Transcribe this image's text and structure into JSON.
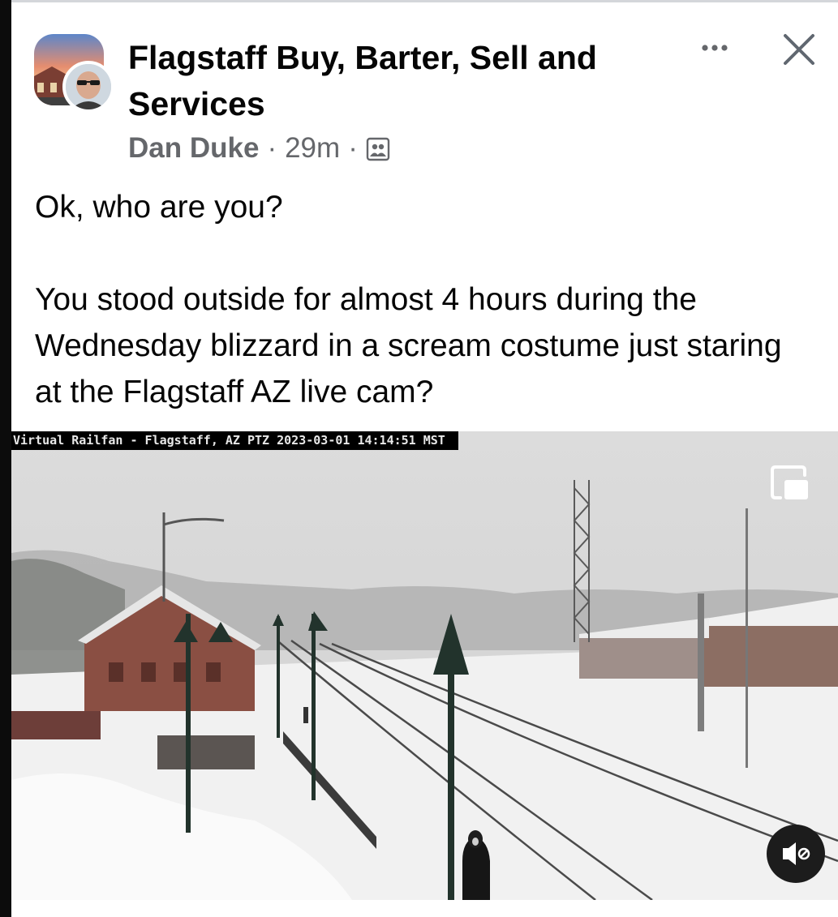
{
  "post": {
    "group_name": "Flagstaff Buy, Barter, Sell and Services",
    "author": "Dan Duke",
    "separator": "·",
    "time_ago": "29m",
    "audience_icon": "group-members-icon",
    "more_icon": "more-options-icon",
    "close_icon": "close-icon",
    "text_line_1": "Ok, who are you?",
    "text_line_2": "You stood outside for almost 4 hours during the Wednesday blizzard in a scream costume just staring at the Flagstaff AZ live cam?"
  },
  "video": {
    "overlay_text": "Virtual Railfan - Flagstaff, AZ PTZ 2023-03-01 14:14:51 MST",
    "pip_icon": "picture-in-picture-icon",
    "mute_icon": "speaker-muted-icon"
  },
  "colors": {
    "text_primary": "#050505",
    "text_secondary": "#65676b",
    "snow": "#f2f2f2",
    "sky": "#d9d9d9",
    "depot_brick": "#8a4f43"
  }
}
